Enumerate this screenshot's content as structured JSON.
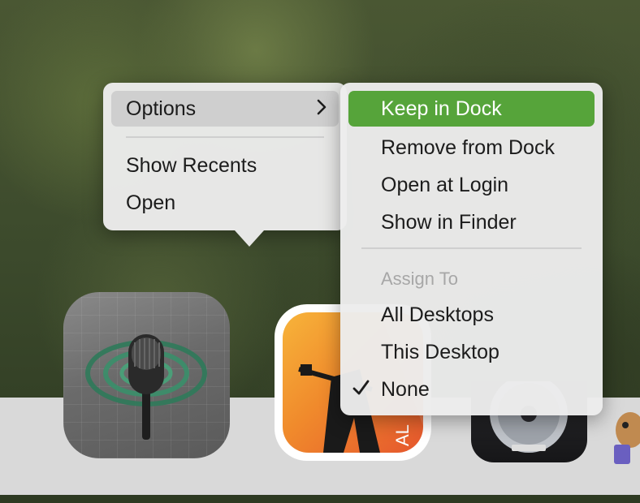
{
  "context_menu": {
    "options_label": "Options",
    "show_recents_label": "Show Recents",
    "open_label": "Open"
  },
  "options_submenu": {
    "keep_in_dock_label": "Keep in Dock",
    "remove_from_dock_label": "Remove from Dock",
    "open_at_login_label": "Open at Login",
    "show_in_finder_label": "Show in Finder",
    "assign_to_heading": "Assign To",
    "all_desktops_label": "All Desktops",
    "this_desktop_label": "This Desktop",
    "none_label": "None",
    "none_checked": true
  },
  "dock": {
    "apps": [
      {
        "icon": "podcast-microphone-icon"
      },
      {
        "icon": "guitar-app-icon"
      },
      {
        "icon": "logic-pro-icon"
      },
      {
        "icon": "beaver-app-icon"
      }
    ]
  },
  "colors": {
    "highlight": "#56a43a",
    "menu_bg": "#ececec",
    "dock_bg": "#d9d9d9"
  }
}
